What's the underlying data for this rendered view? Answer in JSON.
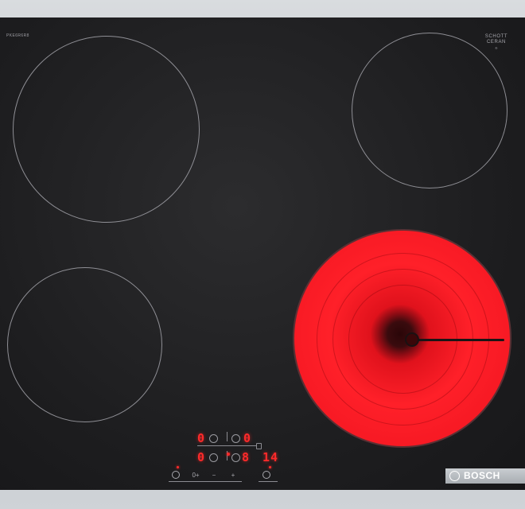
{
  "hob": {
    "model_code": "PKE6R6R8",
    "glass_brand_line1": "SCHOTT",
    "glass_brand_line2": "CERAN",
    "glass_brand_line3": "®",
    "zones": [
      {
        "id": "front-left",
        "state": "off"
      },
      {
        "id": "rear-right",
        "state": "off"
      },
      {
        "id": "rear-left",
        "state": "off"
      },
      {
        "id": "front-right",
        "state": "on"
      }
    ],
    "colors": {
      "glow": "#ff2029",
      "display": "#ff2a2a",
      "glass": "#1d1d1f",
      "frame": "#c4c8cc"
    }
  },
  "control_panel": {
    "display_top_left": "0",
    "display_top_right": "0",
    "display_bottom_left": "0",
    "display_bottom_right": "8",
    "timer_value": "14",
    "power_icon": "power-icon",
    "plus_label": "+",
    "minus_label": "−",
    "zone_select_label": "0+"
  },
  "brand": {
    "name": "BOSCH",
    "icon": "bosch-armature-icon"
  }
}
